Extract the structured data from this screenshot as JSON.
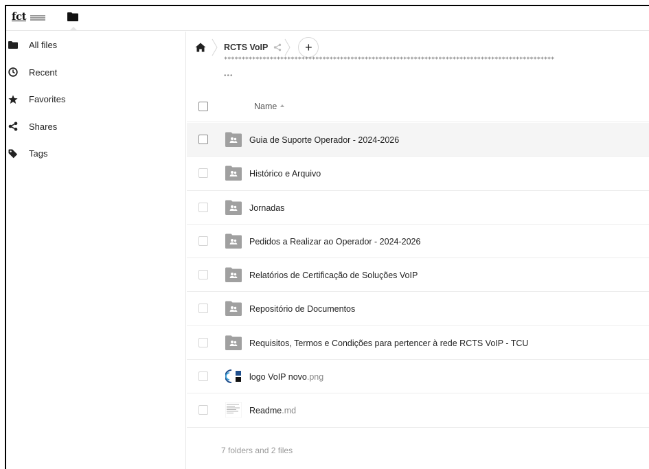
{
  "header": {
    "logo_text": "fct"
  },
  "sidebar": {
    "items": [
      {
        "label": "All files",
        "icon": "folder-icon"
      },
      {
        "label": "Recent",
        "icon": "clock-icon"
      },
      {
        "label": "Favorites",
        "icon": "star-icon"
      },
      {
        "label": "Shares",
        "icon": "share-icon"
      },
      {
        "label": "Tags",
        "icon": "tag-icon"
      }
    ]
  },
  "breadcrumb": {
    "current": "RCTS VoIP",
    "masked_text": "**********************************************************************************************",
    "more": "•••"
  },
  "table": {
    "column_name": "Name",
    "rows": [
      {
        "name": "Guia de Suporte Operador - 2024-2026",
        "ext": "",
        "type": "shared-folder"
      },
      {
        "name": "Histórico e Arquivo",
        "ext": "",
        "type": "shared-folder"
      },
      {
        "name": "Jornadas",
        "ext": "",
        "type": "shared-folder"
      },
      {
        "name": "Pedidos a Realizar ao Operador - 2024-2026",
        "ext": "",
        "type": "shared-folder"
      },
      {
        "name": "Relatórios de Certificação de Soluções VoIP",
        "ext": "",
        "type": "shared-folder"
      },
      {
        "name": "Repositório de Documentos",
        "ext": "",
        "type": "shared-folder"
      },
      {
        "name": "Requisitos, Termos e Condições para pertencer à rede RCTS VoIP - TCU",
        "ext": "",
        "type": "shared-folder"
      },
      {
        "name": "logo VoIP novo",
        "ext": ".png",
        "type": "image"
      },
      {
        "name": "Readme",
        "ext": ".md",
        "type": "document"
      }
    ],
    "summary": "7 folders and 2 files"
  },
  "colors": {
    "folder": "#a0a0a0",
    "hover_row": "#f5f5f5",
    "border": "#ededed"
  }
}
